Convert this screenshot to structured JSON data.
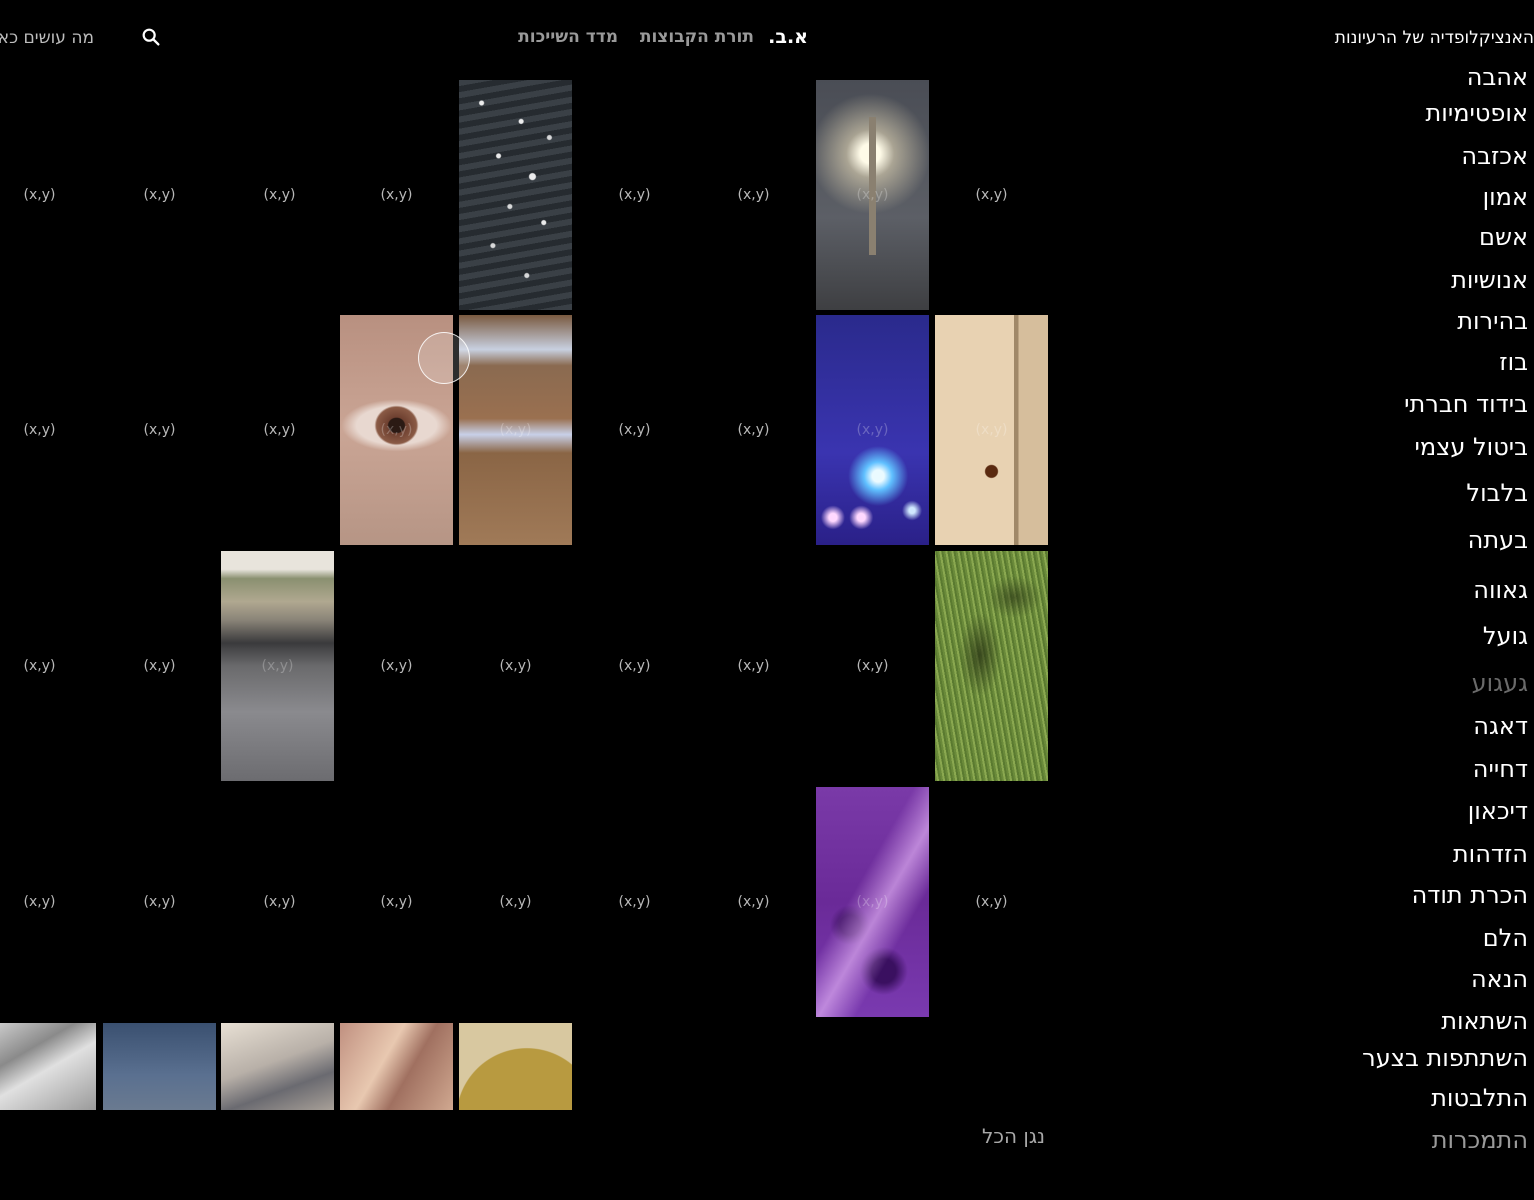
{
  "header": {
    "site_title": "האנציקלופדיה של הרעיונות",
    "nav": [
      "א.ב.",
      "תורת הקבוצות",
      "מדד השייכות"
    ],
    "about": "מה עושים כאן"
  },
  "grid": {
    "coord_label": "(x,y)"
  },
  "index": {
    "items": [
      "אהבה",
      "אופטימיות",
      "אכזבה",
      "אמון",
      "אשם",
      "אנושיות",
      "בהירות",
      "בוז",
      "בידוד חברתי",
      "ביטול עצמי",
      "בלבול",
      "בעתה",
      "גאווה",
      "גועל",
      "געגוע",
      "דאגה",
      "דחייה",
      "דיכאון",
      "הזדהות",
      "הכרת תודה",
      "הלם",
      "הנאה",
      "השתאות",
      "השתתפות בצער",
      "התלבטות",
      "התמכרות"
    ]
  },
  "footer": {
    "play_all": "נגן הכל"
  },
  "icons": {
    "search": "search-icon"
  }
}
